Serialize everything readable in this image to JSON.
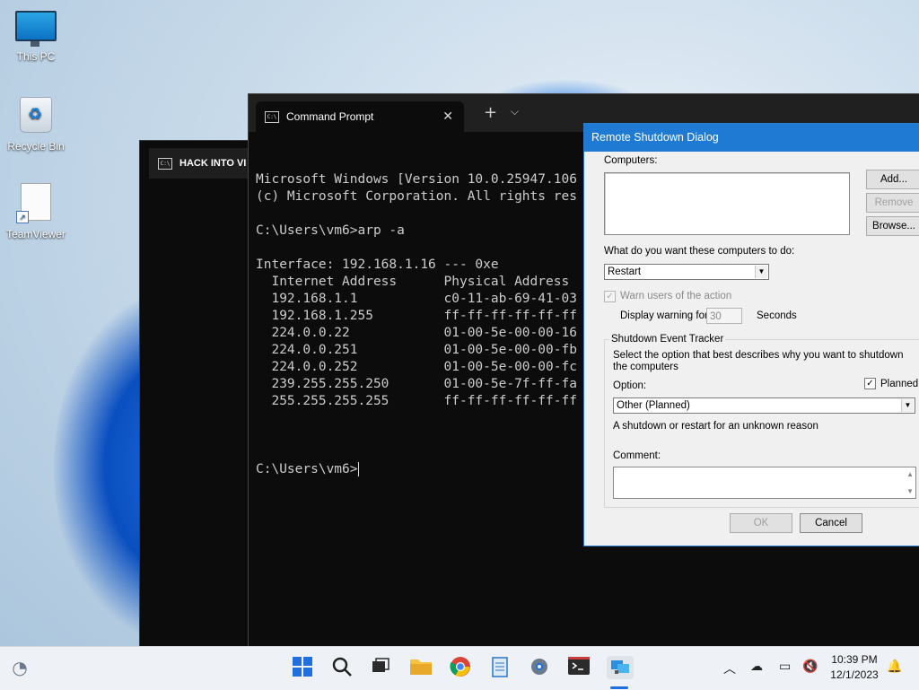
{
  "desktop": {
    "icons": [
      {
        "label": "This PC",
        "icon": "monitor-icon"
      },
      {
        "label": "Recycle Bin",
        "icon": "recycle-bin-icon"
      },
      {
        "label": "TeamViewer",
        "icon": "shortcut-file-icon"
      }
    ]
  },
  "back_window": {
    "tab_title": "HACK INTO VI"
  },
  "terminal": {
    "tab_title": "Command Prompt",
    "lines": [
      "Microsoft Windows [Version 10.0.25947.106",
      "(c) Microsoft Corporation. All rights res",
      "",
      "C:\\Users\\vm6>arp -a",
      "",
      "Interface: 192.168.1.16 --- 0xe",
      "  Internet Address      Physical Address",
      "  192.168.1.1           c0-11-ab-69-41-03",
      "  192.168.1.255         ff-ff-ff-ff-ff-ff",
      "  224.0.0.22            01-00-5e-00-00-16",
      "  224.0.0.251           01-00-5e-00-00-fb",
      "  224.0.0.252           01-00-5e-00-00-fc",
      "  239.255.255.250       01-00-5e-7f-ff-fa",
      "  255.255.255.255       ff-ff-ff-ff-ff-ff",
      ""
    ],
    "prompt": "C:\\Users\\vm6>"
  },
  "dialog": {
    "title": "Remote Shutdown Dialog",
    "computers_label": "Computers:",
    "add_button": "Add...",
    "remove_button": "Remove",
    "browse_button": "Browse...",
    "action_label": "What do you want these computers to do:",
    "action_value": "Restart",
    "warn_label": "Warn users of the action",
    "display_warning_label": "Display warning for",
    "warning_seconds": "30",
    "seconds_label": "Seconds",
    "tracker_title": "Shutdown Event Tracker",
    "tracker_desc": "Select the option that best describes why you want to shutdown the computers",
    "option_label": "Option:",
    "planned_label": "Planned",
    "option_value": "Other (Planned)",
    "option_desc": "A shutdown or restart for an unknown reason",
    "comment_label": "Comment:",
    "ok_button": "OK",
    "cancel_button": "Cancel"
  },
  "taskbar": {
    "time": "10:39 PM",
    "date": "12/1/2023"
  }
}
